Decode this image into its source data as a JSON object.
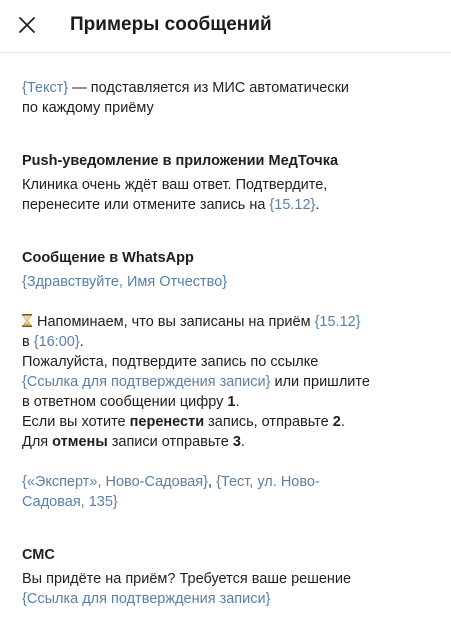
{
  "header": {
    "close_icon": "close-icon",
    "title": "Примеры сообщений"
  },
  "intro": {
    "var": "{Текст}",
    "text_line1": " — подставляется из МИС автоматически",
    "text_line2": "по каждому приёму"
  },
  "push": {
    "title": "Push-уведомление в приложении МедТочка",
    "line1": "Клиника очень ждёт ваш ответ. Подтвердите,",
    "line2_text": "перенесите или отмените запись на ",
    "line2_var": "{15.12}",
    "line2_end": "."
  },
  "whatsapp": {
    "title": "Сообщение в WhatsApp",
    "greeting": "{Здравствуйте, Имя Отчество}",
    "l1_text": "Напоминаем, что вы записаны на приём ",
    "l1_var": "{15.12}",
    "l2_pre": "в ",
    "l2_var": "{16:00}",
    "l2_end": ".",
    "l3": "Пожалуйста, подтвердите запись по ссылке",
    "l4_var": "{Ссылка для подтверждения записи}",
    "l4_text": " или пришлите",
    "l5_text": "в ответном сообщении цифру ",
    "l5_num": "1",
    "l5_end": ".",
    "l6_pre": "Если вы хотите ",
    "l6_bold": "перенести",
    "l6_mid": " запись, отправьте ",
    "l6_num": "2",
    "l6_end": ".",
    "l7_pre": "Для ",
    "l7_bold": "отмены",
    "l7_mid": " записи отправьте ",
    "l7_num": "3",
    "l7_end": ".",
    "sig_var1": "{«Эксперт», Ново-Садовая}",
    "sig_sep": ", ",
    "sig_var2_l1": "{Тест, ул. Ново-",
    "sig_var2_l2": "Садовая, 135}"
  },
  "sms": {
    "title": "СМС",
    "line1": "Вы придёте на приём? Требуется ваше решение",
    "line2_var": "{Ссылка для подтверждения записи}"
  },
  "colors": {
    "variable": "#5a7fa8",
    "text": "#1f1f1f",
    "hourglass": "#e0a23a"
  }
}
